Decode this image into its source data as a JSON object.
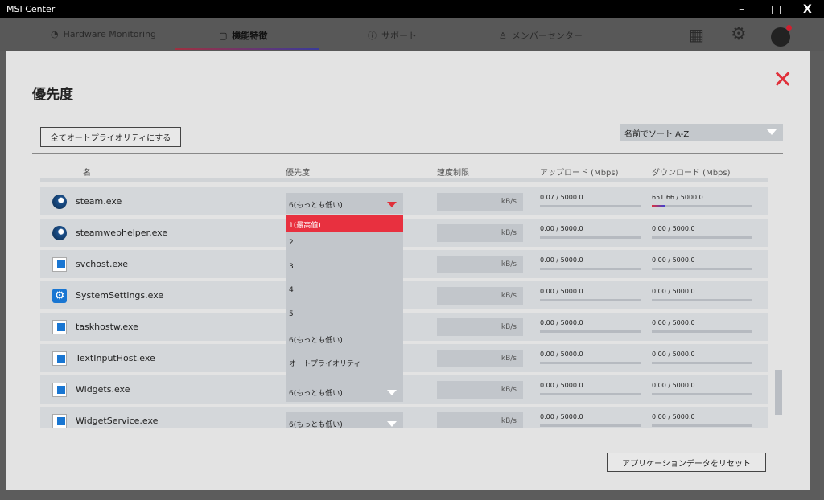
{
  "window": {
    "title": "MSI Center",
    "controls": [
      "–",
      "□",
      "X"
    ]
  },
  "nav": {
    "tabs": [
      {
        "label": "Hardware Monitoring",
        "icon": "gauge-icon"
      },
      {
        "label": "機能特徴",
        "icon": "feature-icon",
        "active": true
      },
      {
        "label": "サポート",
        "icon": "support-icon"
      },
      {
        "label": "メンバーセンター",
        "icon": "member-icon"
      }
    ]
  },
  "modal": {
    "title": "優先度",
    "close_icon": "close-icon",
    "auto_priority_button": "全てオートプライオリティにする",
    "sort": {
      "selected": "名前でソート A-Z"
    },
    "columns": [
      "名",
      "優先度",
      "速度制限",
      "アップロード (Mbps)",
      "ダウンロード (Mbps)"
    ],
    "unit": "kB/s",
    "rows": [
      {
        "name": "steam.exe",
        "icon": "steam-icon",
        "priority": "6(もっとも低い)",
        "upload": "0.07 / 5000.0",
        "download": "651.66 / 5000.0",
        "download_pct": 13
      },
      {
        "name": "steamwebhelper.exe",
        "icon": "steam-icon",
        "upload": "0.00 / 5000.0",
        "download": "0.00 / 5000.0"
      },
      {
        "name": "svchost.exe",
        "icon": "window-icon",
        "upload": "0.00 / 5000.0",
        "download": "0.00 / 5000.0"
      },
      {
        "name": "SystemSettings.exe",
        "icon": "gear-icon",
        "upload": "0.00 / 5000.0",
        "download": "0.00 / 5000.0"
      },
      {
        "name": "taskhostw.exe",
        "icon": "window-icon",
        "upload": "0.00 / 5000.0",
        "download": "0.00 / 5000.0"
      },
      {
        "name": "TextInputHost.exe",
        "icon": "window-icon",
        "upload": "0.00 / 5000.0",
        "download": "0.00 / 5000.0"
      },
      {
        "name": "Widgets.exe",
        "icon": "window-icon",
        "priority": "6(もっとも低い)",
        "upload": "0.00 / 5000.0",
        "download": "0.00 / 5000.0"
      },
      {
        "name": "WidgetService.exe",
        "icon": "window-icon",
        "priority": "6(もっとも低い)",
        "upload": "0.00 / 5000.0",
        "download": "0.00 / 5000.0"
      }
    ],
    "dropdown_options": [
      "1(最高値)",
      "2",
      "3",
      "4",
      "5",
      "6(もっとも低い)",
      "オートプライオリティ"
    ],
    "reset_button": "アプリケーションデータをリセット"
  },
  "colors": {
    "accent": "#e8303f"
  }
}
